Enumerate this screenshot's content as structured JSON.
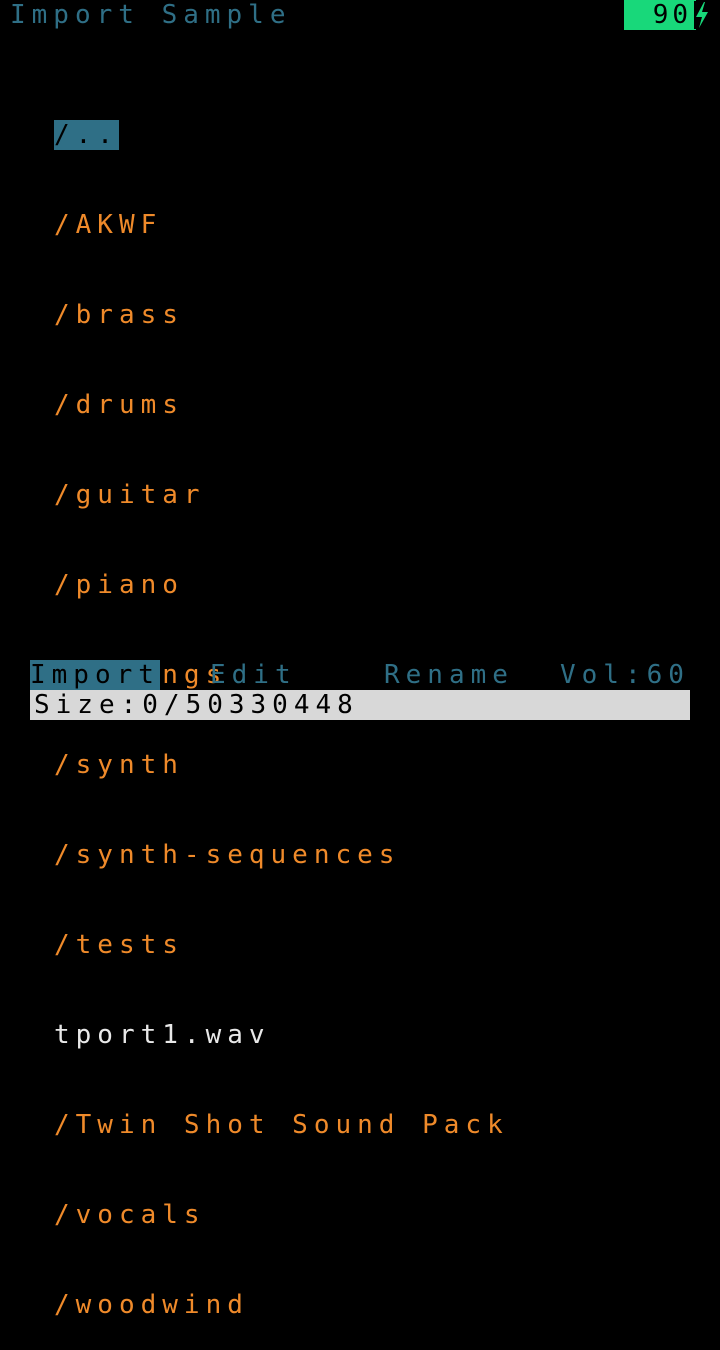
{
  "header": {
    "title": "Import Sample",
    "battery_level": "90",
    "battery_icon": "charging-bolt-icon"
  },
  "browser": {
    "selected_index": 0,
    "entries": [
      {
        "label": "/..",
        "kind": "dir"
      },
      {
        "label": "/AKWF",
        "kind": "dir"
      },
      {
        "label": "/brass",
        "kind": "dir"
      },
      {
        "label": "/drums",
        "kind": "dir"
      },
      {
        "label": "/guitar",
        "kind": "dir"
      },
      {
        "label": "/piano",
        "kind": "dir"
      },
      {
        "label": "/strings",
        "kind": "dir"
      },
      {
        "label": "/synth",
        "kind": "dir"
      },
      {
        "label": "/synth-sequences",
        "kind": "dir"
      },
      {
        "label": "/tests",
        "kind": "dir"
      },
      {
        "label": "tport1.wav",
        "kind": "file"
      },
      {
        "label": "/Twin Shot Sound Pack",
        "kind": "dir"
      },
      {
        "label": "/vocals",
        "kind": "dir"
      },
      {
        "label": "/woodwind",
        "kind": "dir"
      }
    ]
  },
  "menu": {
    "import_label": "Import",
    "edit_label": "Edit",
    "rename_label": "Rename",
    "vol_label": "Vol:60"
  },
  "status": {
    "size_text": "Size:0/50330448"
  },
  "colors": {
    "accent_blue": "#2f6f86",
    "directory_orange": "#ef8a2a",
    "file_white": "#e8e8e8",
    "battery_green": "#18d87a",
    "status_gray": "#d8d8d8",
    "background": "#000000"
  }
}
